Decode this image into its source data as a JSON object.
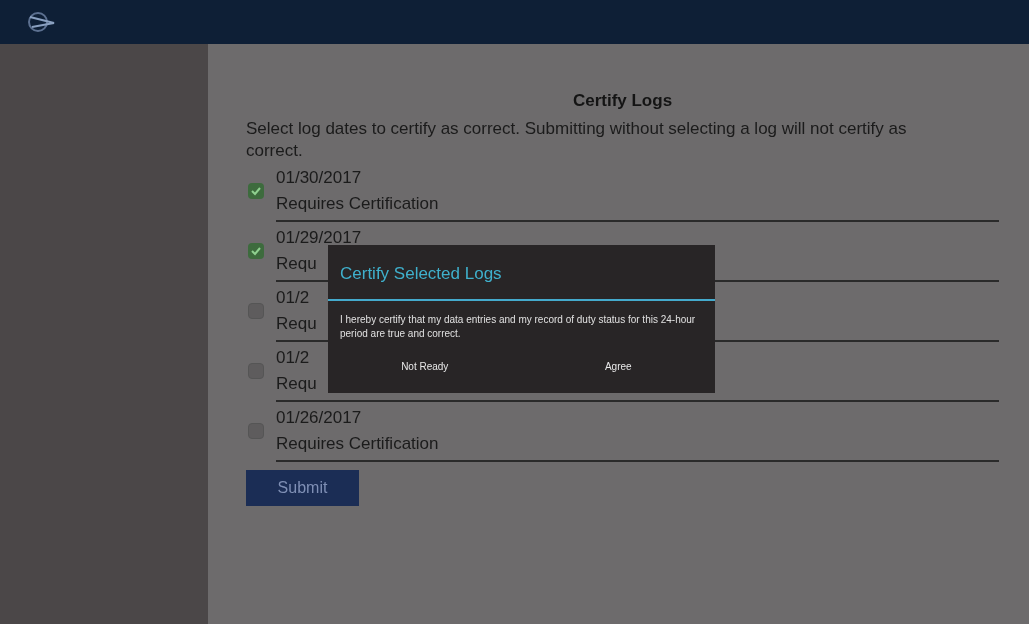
{
  "page": {
    "title": "Certify Logs",
    "instructions": "Select log dates to certify as correct. Submitting without selecting a log will not certify as correct."
  },
  "logs": [
    {
      "date": "01/30/2017",
      "status": "Requires Certification",
      "checked": true
    },
    {
      "date": "01/29/2017",
      "status": "Requ",
      "checked": true
    },
    {
      "date": "01/2",
      "status": "Requ",
      "checked": false
    },
    {
      "date": "01/2",
      "status": "Requ",
      "checked": false
    },
    {
      "date": "01/26/2017",
      "status": "Requires Certification",
      "checked": false
    }
  ],
  "submit_button": "Submit",
  "dialog": {
    "title": "Certify Selected Logs",
    "message": "I hereby certify that my data entries and my record of duty status for this 24-hour period are true and correct.",
    "buttons": [
      "Not Ready",
      "Agree"
    ]
  }
}
